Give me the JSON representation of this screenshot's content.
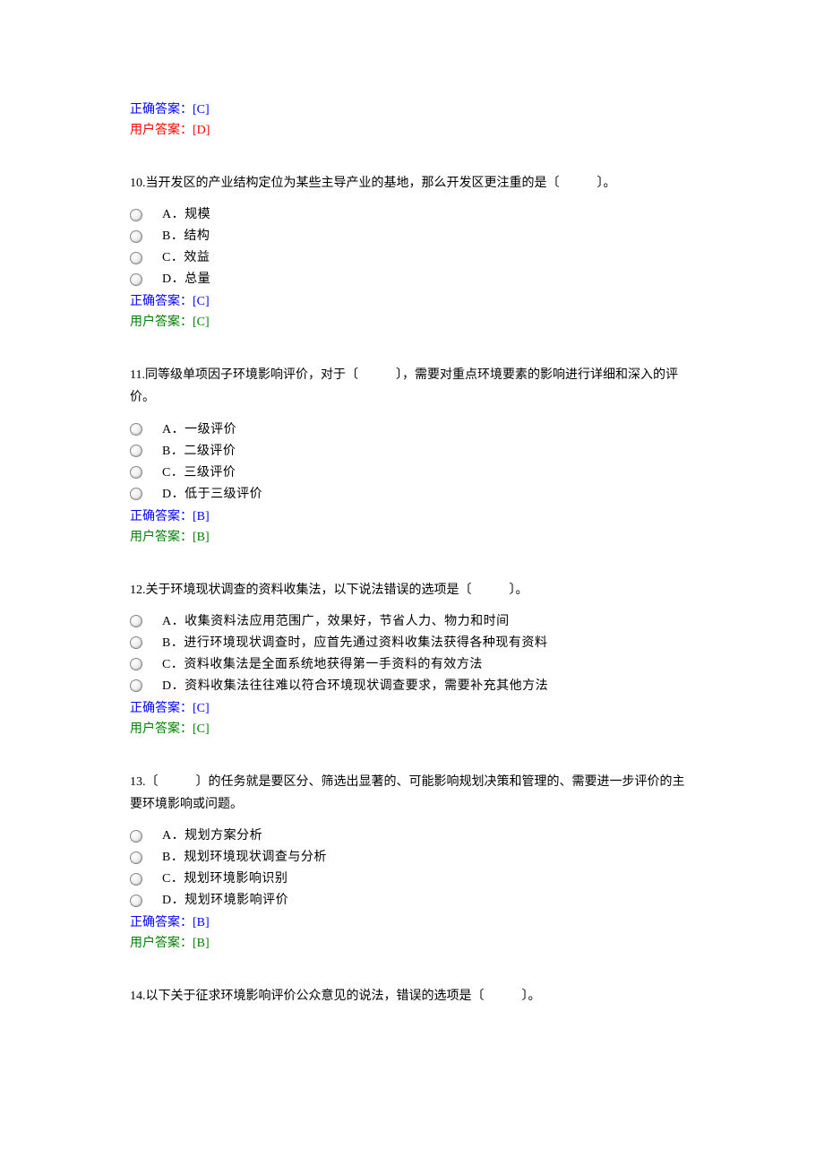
{
  "labels": {
    "correct_prefix": "正确答案：",
    "user_prefix": "用户答案："
  },
  "prev_tail": {
    "correct": "[C]",
    "user": "[D]"
  },
  "questions": [
    {
      "number": "10",
      "text": "10.当开发区的产业结构定位为某些主导产业的基地，那么开发区更注重的是〔　　　〕。",
      "options": [
        "A．规模",
        "B．结构",
        "C．效益",
        "D．总量"
      ],
      "correct": "[C]",
      "user": "[C]",
      "user_correct": true
    },
    {
      "number": "11",
      "text": "11.同等级单项因子环境影响评价，对于〔　　　〕，需要对重点环境要素的影响进行详细和深入的评价。",
      "options": [
        "A．一级评价",
        "B．二级评价",
        "C．三级评价",
        "D．低于三级评价"
      ],
      "correct": "[B]",
      "user": "[B]",
      "user_correct": true
    },
    {
      "number": "12",
      "text": "12.关于环境现状调查的资料收集法，以下说法错误的选项是〔　　　〕。",
      "options": [
        "A．收集资料法应用范围广，效果好，节省人力、物力和时间",
        "B．进行环境现状调查时，应首先通过资料收集法获得各种现有资料",
        "C．资料收集法是全面系统地获得第一手资料的有效方法",
        "D．资料收集法往往难以符合环境现状调查要求，需要补充其他方法"
      ],
      "correct": "[C]",
      "user": "[C]",
      "user_correct": true
    },
    {
      "number": "13",
      "text": "13.〔　　　〕的任务就是要区分、筛选出显著的、可能影响规划决策和管理的、需要进一步评价的主要环境影响或问题。",
      "options": [
        "A．规划方案分析",
        "B．规划环境现状调查与分析",
        "C．规划环境影响识别",
        "D．规划环境影响评价"
      ],
      "correct": "[B]",
      "user": "[B]",
      "user_correct": true
    },
    {
      "number": "14",
      "text": "14.以下关于征求环境影响评价公众意见的说法，错误的选项是〔　　　〕。",
      "options": [],
      "correct": null,
      "user": null
    }
  ]
}
